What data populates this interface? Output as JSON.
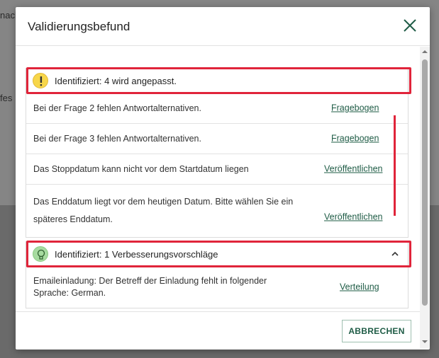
{
  "background": {
    "text_top": "nach",
    "text_mid": "fes"
  },
  "dialog": {
    "title": "Validierungsbefund",
    "close_icon": "close-icon"
  },
  "warnings": {
    "icon": "exclamation-icon",
    "header": "Identifiziert: 4 wird angepasst.",
    "items": [
      {
        "message": "Bei der Frage 2 fehlen Antwortalternativen.",
        "link": "Fragebogen"
      },
      {
        "message": "Bei der Frage 3 fehlen Antwortalternativen.",
        "link": "Fragebogen"
      },
      {
        "message": "Das Stoppdatum kann nicht vor dem Startdatum liegen",
        "link": "Veröffentlichen"
      },
      {
        "message": "Das Enddatum liegt vor dem heutigen Datum. Bitte wählen Sie ein späteres Enddatum.",
        "link": "Veröffentlichen"
      }
    ]
  },
  "suggestions": {
    "icon": "lightbulb-icon",
    "header": "Identifiziert: 1 Verbesserungsvorschläge",
    "items": [
      {
        "message": "Emaileinladung: Der Betreff der Einladung fehlt in folgender Sprache: German.",
        "link": "Verteilung"
      }
    ]
  },
  "footer": {
    "cancel_label": "ABBRECHEN"
  },
  "colors": {
    "accent": "#1f5c46",
    "highlight": "#e0243a",
    "warning": "#f7d64a",
    "hint": "#a7dba0"
  }
}
